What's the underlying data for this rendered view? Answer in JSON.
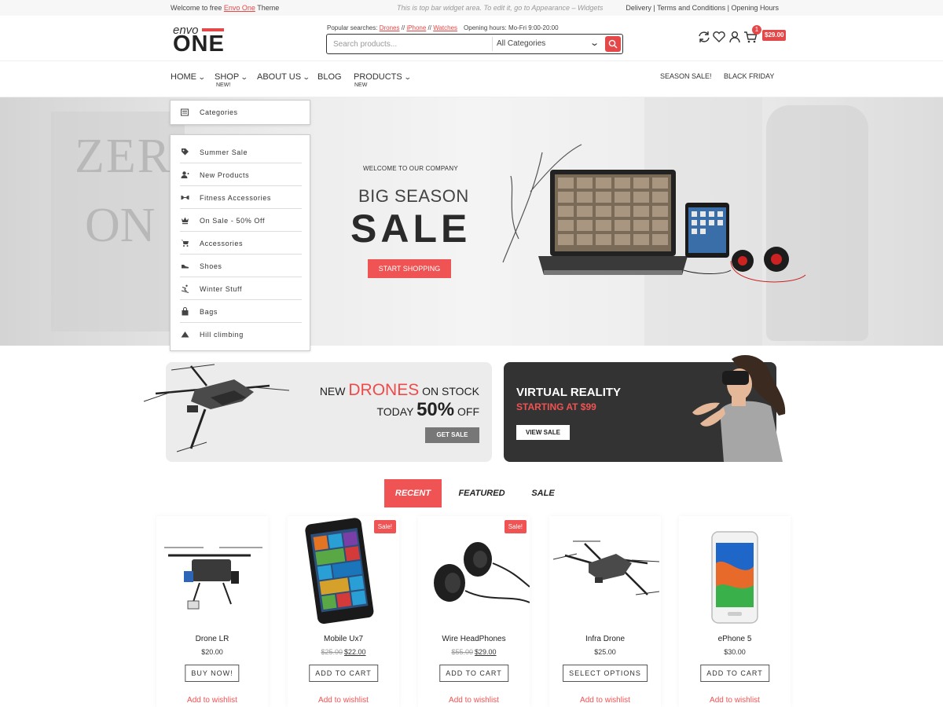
{
  "topbar": {
    "welcome_prefix": "Welcome to free ",
    "theme_link": "Envo One",
    "welcome_suffix": " Theme",
    "widget_note": "This is top bar widget area. To edit it, go to Appearance – Widgets",
    "links": "Delivery | Terms and Conditions | Opening Hours"
  },
  "header": {
    "logo_small": "envo",
    "logo_big": "ONE",
    "popular_label": "Popular searches: ",
    "popular_terms": [
      "Drones",
      "iPhone",
      "Watches"
    ],
    "popular_sep": " // ",
    "opening_hours": "Opening hours: Mo-Fri 9:00-20:00",
    "search_placeholder": "Search products...",
    "category_select": "All Categories",
    "cart_count": "1",
    "cart_total": "$29.00"
  },
  "nav": {
    "items": [
      {
        "label": "HOME",
        "caret": true
      },
      {
        "label": "SHOP",
        "caret": true,
        "sub": "NEW!"
      },
      {
        "label": "ABOUT US",
        "caret": true
      },
      {
        "label": "BLOG",
        "caret": false
      },
      {
        "label": "PRODUCTS",
        "caret": true,
        "sub": "NEW"
      }
    ],
    "right": [
      "SEASON SALE!",
      "BLACK FRIDAY"
    ]
  },
  "categories": {
    "title": "Categories",
    "items": [
      {
        "label": "Summer Sale",
        "icon": "tag-icon"
      },
      {
        "label": "New Products",
        "icon": "user-plus-icon"
      },
      {
        "label": "Fitness Accessories",
        "icon": "dumbbell-icon"
      },
      {
        "label": "On Sale - 50% Off",
        "icon": "crown-icon"
      },
      {
        "label": "Accessories",
        "icon": "cart-icon"
      },
      {
        "label": "Shoes",
        "icon": "shoe-icon"
      },
      {
        "label": "Winter Stuff",
        "icon": "skiing-icon"
      },
      {
        "label": "Bags",
        "icon": "bag-icon"
      },
      {
        "label": "Hill climbing",
        "icon": "mountain-icon"
      }
    ]
  },
  "hero": {
    "bg_text_1": "ZER",
    "bg_text_2": "ON",
    "welcome": "WELCOME TO OUR COMPANY",
    "headline_1": "BIG SEASON",
    "headline_2": "SALE",
    "cta": "START SHOPPING"
  },
  "promo_drones": {
    "new": "NEW ",
    "drones": "DRONES",
    "on_stock": " ON STOCK",
    "today": "TODAY ",
    "percent": "50%",
    "off": " OFF",
    "button": "GET SALE"
  },
  "promo_vr": {
    "title": "VIRTUAL REALITY",
    "subtitle": "STARTING AT $99",
    "button": "VIEW SALE"
  },
  "tabs": [
    "RECENT",
    "FEATURED",
    "SALE"
  ],
  "products": [
    {
      "name": "Drone LR",
      "price": "$20.00",
      "old_price": "",
      "sale": "",
      "button": "BUY NOW!",
      "wishlist": "Add to wishlist"
    },
    {
      "name": "Mobile Ux7",
      "price": "$22.00",
      "old_price": "$25.00",
      "sale": "Sale!",
      "button": "ADD TO CART",
      "wishlist": "Add to wishlist"
    },
    {
      "name": "Wire HeadPhones",
      "price": "$29.00",
      "old_price": "$55.00",
      "sale": "Sale!",
      "button": "ADD TO CART",
      "wishlist": "Add to wishlist"
    },
    {
      "name": "Infra Drone",
      "price": "$25.00",
      "old_price": "",
      "sale": "",
      "button": "SELECT OPTIONS",
      "wishlist": "Add to wishlist"
    },
    {
      "name": "ePhone 5",
      "price": "$30.00",
      "old_price": "",
      "sale": "",
      "button": "ADD TO CART",
      "wishlist": "Add to wishlist"
    }
  ],
  "colors": {
    "accent": "#ef5353",
    "dark": "#333333"
  }
}
